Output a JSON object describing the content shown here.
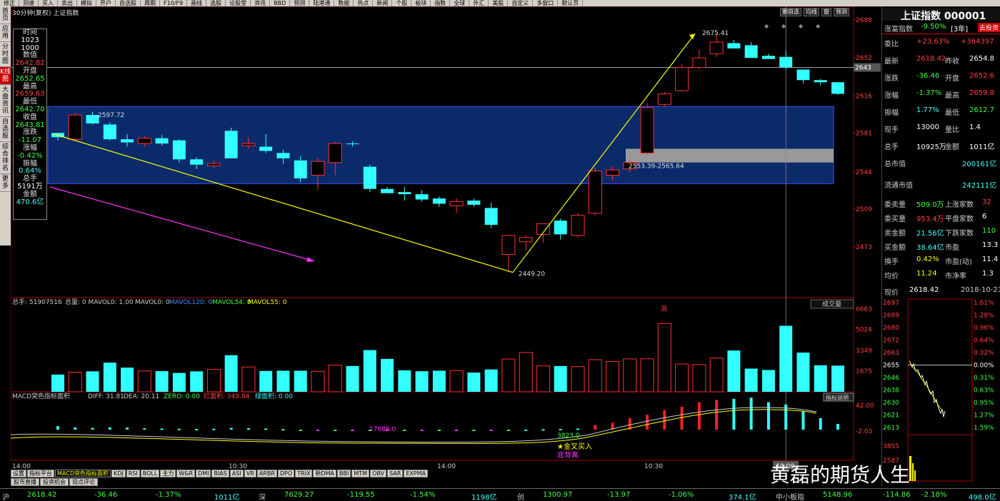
{
  "toolbar": [
    "修正",
    "测速",
    "买入",
    "卖出",
    "模拟",
    "开户",
    "自选股",
    "周期",
    "F10/F9",
    "画线",
    "选股",
    "论股堂",
    "资讯",
    "BBD",
    "预测",
    "陆港通",
    "数据",
    "热点",
    "新闻",
    "个股",
    "板块",
    "指数",
    "全球",
    "外汇",
    "美股",
    "自定义",
    "多窗口",
    "默认页"
  ],
  "left_nav": [
    "首页",
    "应用",
    "分时图",
    "K线图",
    "大盘资讯",
    "自选股",
    "综合排名",
    "更多"
  ],
  "left_nav_active": 3,
  "chart": {
    "title": "30分钟(复权)   上证指数",
    "tools": [
      "删自选",
      "均线",
      "窗",
      "预测"
    ],
    "high_label": "2675.41",
    "low_label": "2449.20",
    "left_high_label": "2597.72",
    "band_label": "2553.39-2565.64",
    "current_price_label": "2643",
    "price_ticks": [
      "2688",
      "2652",
      "2616",
      "2581",
      "2544",
      "2509",
      "2473"
    ],
    "time_ticks": [
      "14:00",
      "10:30",
      "14:00",
      "10:30"
    ],
    "cursor_time": "10:00"
  },
  "infobox": {
    "time_label": "时间",
    "time_val1": "1023",
    "time_val2": "1000",
    "value_label": "数值",
    "value_val": "2642.82",
    "open_label": "开盘",
    "open_val": "2652.65",
    "high_label": "最高",
    "high_val": "2659.63",
    "low_label": "最低",
    "low_val": "2642.70",
    "close_label": "收盘",
    "close_val": "2643.81",
    "chg_label": "涨跌",
    "chg_val": "-11.07",
    "pct_label": "涨幅",
    "pct_val": "-0.42%",
    "amp_label": "振幅",
    "amp_val": "0.64%",
    "vol_label": "总手",
    "vol_val": "5191万",
    "amt_label": "金额",
    "amt_val": "470.6亿"
  },
  "volume": {
    "header_total": "总手: 51907516",
    "header_rest": "总量: 0  MAVOL0: 1.00",
    "mavol0": "MAVOL0: 0",
    "mavol120": "MAVOL120: 0",
    "mavol54": "MAVOL54: 0",
    "mavol55": "MAVOL55: 0",
    "selector": "成交量",
    "ticks": [
      "6663",
      "5024",
      "3349",
      "1675"
    ],
    "high_mark": "高"
  },
  "macd": {
    "name": "MACD突色指标面积",
    "diff": "DIFF: 31.81",
    "dea": "DEA: 20.11",
    "zero": "ZERO: 0.00",
    "red_area": "红面积: 349.84",
    "green_area": "绿面积: 0.00",
    "help": "指标说明",
    "tick_top": "42.00",
    "tick_bot": "-2.03",
    "label_17686": "17686.0",
    "label_3823": "3823.0",
    "signal1": "★金叉买入",
    "signal2": "底背离"
  },
  "bottom_tabs": [
    "设置",
    "指标平台",
    "MACD突色指标面积",
    "KDJ",
    "RSI",
    "BOLL",
    "主力",
    "W&R",
    "DMI",
    "BIAS",
    "ASI",
    "VR",
    "ARBR",
    "DPO",
    "TRIX",
    "新DMA",
    "BBI",
    "MTM",
    "OBV",
    "SAR",
    "EXPMA"
  ],
  "bottom_tabs_active": 2,
  "bottom_tabs2": [
    "股市直播",
    "投资机会",
    "观点评论"
  ],
  "right_panel": {
    "title": "上证指数 000001",
    "wealth_label": "涨富指数",
    "wealth_val": "-9.50%",
    "wealth_period": "[3年]",
    "wealth_btn": "去投资",
    "webi_label": "委比",
    "webi_val": "+23.63%",
    "webi_val2": "+364397",
    "latest_label": "最新",
    "latest_val": "2618.42",
    "prev_label": "昨收",
    "prev_val": "2654.8",
    "chg_label": "涨跌",
    "chg_val": "-36.46",
    "open_label": "开盘",
    "open_val": "2652.6",
    "pct_label": "涨幅",
    "pct_val": "-1.37%",
    "high_label": "最高",
    "high_val": "2659.8",
    "amp_label": "振幅",
    "amp_val": "1.77%",
    "low_label": "最低",
    "low_val": "2612.7",
    "hand_label": "现手",
    "hand_val": "13000",
    "ratio_label": "量比",
    "ratio_val": "1.4",
    "total_label": "总手",
    "total_val": "10925万",
    "amount_label": "金额",
    "amount_val": "1011亿",
    "mktcap_label": "总市值",
    "mktcap_val": "200161亿",
    "float_label": "流通市值",
    "float_val": "242111亿",
    "sell_vol_label": "委卖量",
    "sell_vol_val": "509.0万",
    "up_label": "上涨家数",
    "up_val": "32",
    "buy_vol_label": "委买量",
    "buy_vol_val": "953.4万",
    "flat_label": "平盘家数",
    "flat_val": "6",
    "sell_amt_label": "卖金额",
    "sell_amt_val": "21.56亿",
    "down_label": "下跌家数",
    "down_val": "110",
    "buy_amt_label": "买金额",
    "buy_amt_val": "38.64亿",
    "pe_label": "市盈",
    "pe_val": "13.3",
    "turnover_label": "换手",
    "turnover_val": "0.42%",
    "pe_dyn_label": "市盈(动)",
    "pe_dyn_val": "11.4",
    "avg_label": "均价",
    "avg_val": "11.24",
    "pb_label": "市净率",
    "pb_val": "1.3",
    "mini_price_label": "现价",
    "mini_price_val": "2618.42",
    "mini_date": "2018-10-23",
    "mini_left_ticks": [
      "2697",
      "2689",
      "2680",
      "2672",
      "2663",
      "2655",
      "2646",
      "2638",
      "2630",
      "2621",
      "2613"
    ],
    "mini_right_ticks": [
      "1.61%",
      "1.28%",
      "0.96%",
      "0.64%",
      "0.32%",
      "0.00%",
      "0.31%",
      "0.63%",
      "0.95%",
      "1.27%",
      "1.59%"
    ],
    "mini_vol_ticks": [
      "3855",
      "2587"
    ]
  },
  "status_bar": {
    "sh_label": "沪",
    "sh_val": "2618.42",
    "sh_chg": "-36.46",
    "sh_pct": "-1.37%",
    "sh_amt": "1011亿",
    "sz_label": "深",
    "sz_val": "7629.27",
    "sz_chg": "-119.55",
    "sz_pct": "-1.54%",
    "sz_amt": "1198亿",
    "cy_label": "创",
    "cy_val": "1300.97",
    "cy_chg": "-13.97",
    "cy_pct": "-1.06%",
    "cy_amt": "374.1亿",
    "zx_label": "中小板指",
    "zx_val": "5148.96",
    "zx_chg": "-114.86",
    "zx_pct": "-2.18%",
    "zx_amt": "498.0亿"
  },
  "watermark": "黄磊的期货人生",
  "chart_data": {
    "type": "candlestick",
    "candles": [
      [
        2581,
        2581,
        2574,
        2577,
        0
      ],
      [
        2575,
        2600,
        2573,
        2598,
        1
      ],
      [
        2598,
        2601,
        2589,
        2590,
        0
      ],
      [
        2589,
        2591,
        2574,
        2575,
        0
      ],
      [
        2575,
        2580,
        2568,
        2572,
        0
      ],
      [
        2571,
        2578,
        2568,
        2576,
        1
      ],
      [
        2576,
        2579,
        2569,
        2571,
        0
      ],
      [
        2574,
        2575,
        2553,
        2556,
        0
      ],
      [
        2556,
        2558,
        2547,
        2551,
        0
      ],
      [
        2550,
        2555,
        2547,
        2552,
        1
      ],
      [
        2557,
        2586,
        2558,
        2583,
        0
      ],
      [
        2569,
        2577,
        2566,
        2571,
        1
      ],
      [
        2568,
        2580,
        2562,
        2564,
        0
      ],
      [
        2562,
        2565,
        2552,
        2557,
        0
      ],
      [
        2555,
        2559,
        2534,
        2538,
        0
      ],
      [
        2541,
        2557,
        2527,
        2554,
        1
      ],
      [
        2553,
        2573,
        2541,
        2571,
        1
      ],
      [
        2571,
        2573,
        2568,
        2571,
        0
      ],
      [
        2549,
        2551,
        2525,
        2528,
        0
      ],
      [
        2528,
        2530,
        2525,
        2524,
        0
      ],
      [
        2525,
        2530,
        2517,
        2523,
        0
      ],
      [
        2523,
        2527,
        2516,
        2518,
        0
      ],
      [
        2519,
        2521,
        2511,
        2514,
        0
      ],
      [
        2512,
        2519,
        2505,
        2516,
        1
      ],
      [
        2517,
        2519,
        2511,
        2513,
        0
      ],
      [
        2510,
        2515,
        2491,
        2494,
        0
      ],
      [
        2466,
        2477,
        2449,
        2484,
        1
      ],
      [
        2478,
        2484,
        2470,
        2482,
        1
      ],
      [
        2485,
        2495,
        2477,
        2495,
        1
      ],
      [
        2485,
        2500,
        2480,
        2498,
        0
      ],
      [
        2484,
        2505,
        2482,
        2503,
        1
      ],
      [
        2505,
        2548,
        2503,
        2545,
        1
      ],
      [
        2541,
        2549,
        2536,
        2546,
        1
      ],
      [
        2547,
        2556,
        2544,
        2553,
        1
      ],
      [
        2562,
        2609,
        2560,
        2605,
        1
      ],
      [
        2608,
        2620,
        2606,
        2618,
        1
      ],
      [
        2621,
        2646,
        2620,
        2643,
        1
      ],
      [
        2643,
        2660,
        2641,
        2652,
        1
      ],
      [
        2656,
        2675,
        2653,
        2667,
        1
      ],
      [
        2666,
        2669,
        2666,
        2661,
        0
      ],
      [
        2664,
        2667,
        2652,
        2652,
        0
      ],
      [
        2654,
        2656,
        2653,
        2651,
        0
      ],
      [
        2653,
        2659,
        2641,
        2643,
        0
      ],
      [
        2641,
        2641,
        2628,
        2631,
        0
      ],
      [
        2631,
        2632,
        2626,
        2629,
        0
      ],
      [
        2629,
        2629,
        2617,
        2618,
        0
      ]
    ],
    "volumes": [
      1390,
      1580,
      1650,
      2350,
      1950,
      1680,
      1670,
      1520,
      1650,
      1800,
      2950,
      2000,
      1680,
      1700,
      1700,
      1650,
      2150,
      2080,
      3360,
      2650,
      1730,
      1660,
      1700,
      1700,
      1550,
      1800,
      2640,
      3170,
      2090,
      2080,
      2030,
      2590,
      2440,
      2650,
      2660,
      5500,
      2240,
      2200,
      2720,
      3330,
      1870,
      1760,
      5320,
      3160,
      2140,
      2110
    ],
    "macd": [
      3,
      2,
      1.5,
      2,
      1.8,
      1.2,
      1,
      0.8,
      0.6,
      0.8,
      1.5,
      1.3,
      1,
      0.5,
      -0.2,
      -0.4,
      -0.1,
      -0.5,
      -0.7,
      -0.8,
      -0.9,
      -1,
      -0.8,
      -0.9,
      -1,
      -1.1,
      -0.4,
      0.1,
      0.4,
      0.6,
      1,
      4,
      6,
      10,
      13,
      17,
      20,
      24,
      26,
      27,
      28,
      24,
      22,
      16,
      10,
      5
    ]
  }
}
